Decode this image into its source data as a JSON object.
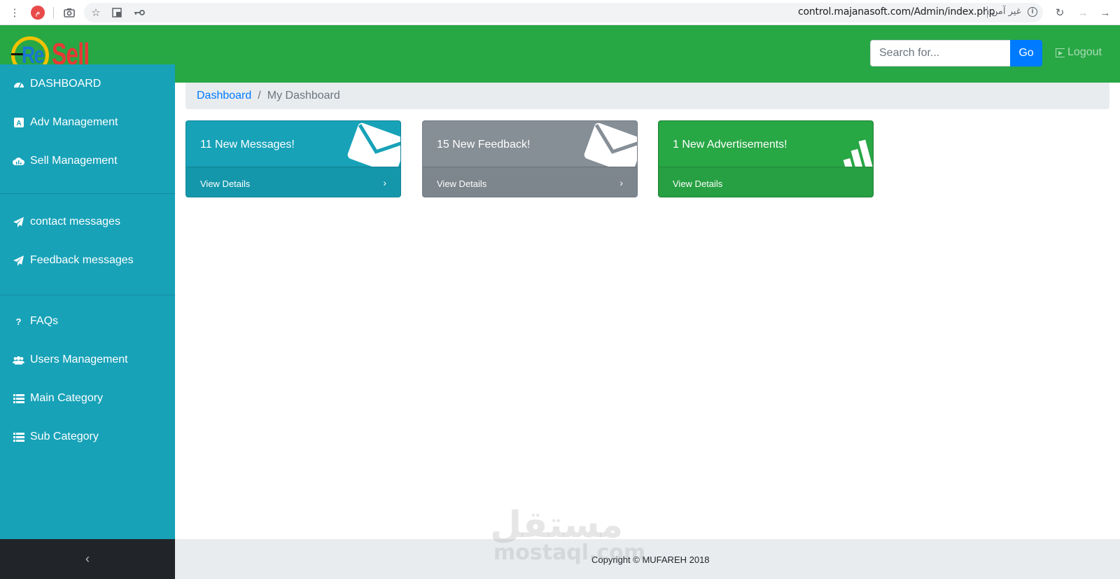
{
  "browser": {
    "profile_initial": "م",
    "url": "control.majanasoft.com/Admin/index.php",
    "security_label": "غير آمن"
  },
  "header": {
    "logo_prefix": "Re",
    "logo_suffix": "Sell",
    "search_placeholder": "Search for...",
    "go_label": "Go",
    "logout_label": "Logout"
  },
  "sidebar": {
    "items": [
      {
        "label": "DASHBOARD",
        "icon": "dashboard-icon"
      },
      {
        "label": "Adv Management",
        "icon": "adv-icon"
      },
      {
        "label": "Sell Management",
        "icon": "cloud-icon"
      },
      {
        "label": "contact messages",
        "icon": "paper-plane-icon"
      },
      {
        "label": "Feedback messages",
        "icon": "paper-plane-icon"
      },
      {
        "label": "FAQs",
        "icon": "question-icon"
      },
      {
        "label": "Users Management",
        "icon": "users-icon"
      },
      {
        "label": "Main Category",
        "icon": "list-icon"
      },
      {
        "label": "Sub Category",
        "icon": "list-icon"
      }
    ],
    "collapse_glyph": "‹"
  },
  "breadcrumb": {
    "link": "Dashboard",
    "separator": "/",
    "current": "My Dashboard"
  },
  "cards": [
    {
      "title": "11 New Messages!",
      "footer": "View Details",
      "color": "#17a2b8",
      "icon": "envelope-icon"
    },
    {
      "title": "15 New Feedback!",
      "footer": "View Details",
      "color": "#868e96",
      "icon": "envelope-icon"
    },
    {
      "title": "1 New Advertisements!",
      "footer": "View Details",
      "color": "#28a745",
      "icon": "signal-icon"
    }
  ],
  "footer": {
    "copyright": "Copyright © MUFAREH 2018"
  },
  "watermark": {
    "arabic": "مستقل",
    "latin": "mostaql.com"
  }
}
